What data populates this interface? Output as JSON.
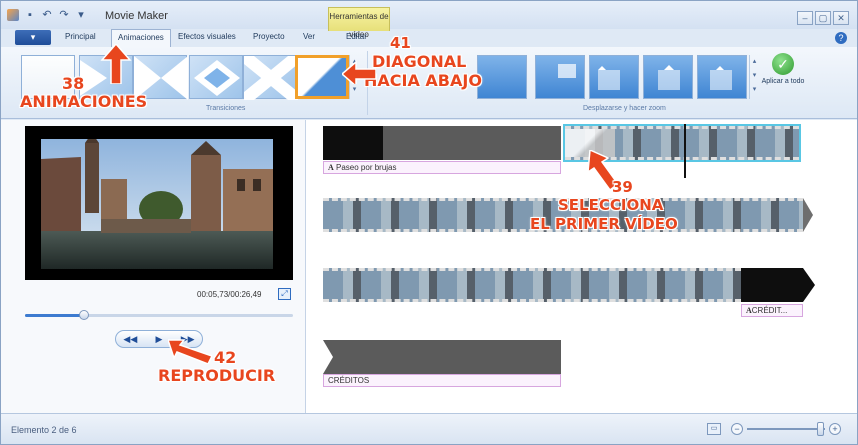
{
  "app": {
    "title": "Movie Maker",
    "context_tab_group": "Herramientas de vídeo",
    "window_buttons": [
      "–",
      "▢",
      "✕"
    ]
  },
  "tabs": {
    "file_label": "▾",
    "items": [
      {
        "label": "Principal"
      },
      {
        "label": "Animaciones"
      },
      {
        "label": "Efectos visuales"
      },
      {
        "label": "Proyecto"
      },
      {
        "label": "Ver"
      },
      {
        "label": "Editar"
      }
    ],
    "active": "Animaciones",
    "help": "?"
  },
  "ribbon": {
    "transitions_group_label": "Transiciones",
    "pan_zoom_group_label": "Desplazarse y hacer zoom",
    "apply_all_label": "Aplicar a todo",
    "selected_transition": "Diagonal hacia abajo"
  },
  "preview": {
    "timecode": "00:05,73/00:26,49",
    "seek_fraction": 0.22,
    "controls": [
      "◀◀",
      "▶",
      "▶▶"
    ]
  },
  "storyboard": {
    "captions": {
      "title_caption": "Paseo por brujas",
      "credit_caption": "CRÉDIT...",
      "credits_caption": "CRÉDITOS"
    },
    "caption_glyph": "A"
  },
  "statusbar": {
    "text": "Elemento 2 de 6"
  },
  "annotations": {
    "a38": {
      "number": "38",
      "text": "ANIMACIONES"
    },
    "a41": {
      "number": "41",
      "line1": "DIAGONAL",
      "line2": "HACIA ABAJO"
    },
    "a39": {
      "number": "39",
      "line1": "SELECCIONA",
      "line2": "EL PRIMER VÍDEO"
    },
    "a42": {
      "number": "42",
      "text": "REPRODUCIR"
    }
  },
  "colors": {
    "annotation": "#e8461e",
    "selection_highlight": "#f1a02a",
    "clip_selection": "#59c7e4",
    "ribbon_blue": "#3f85d3"
  }
}
